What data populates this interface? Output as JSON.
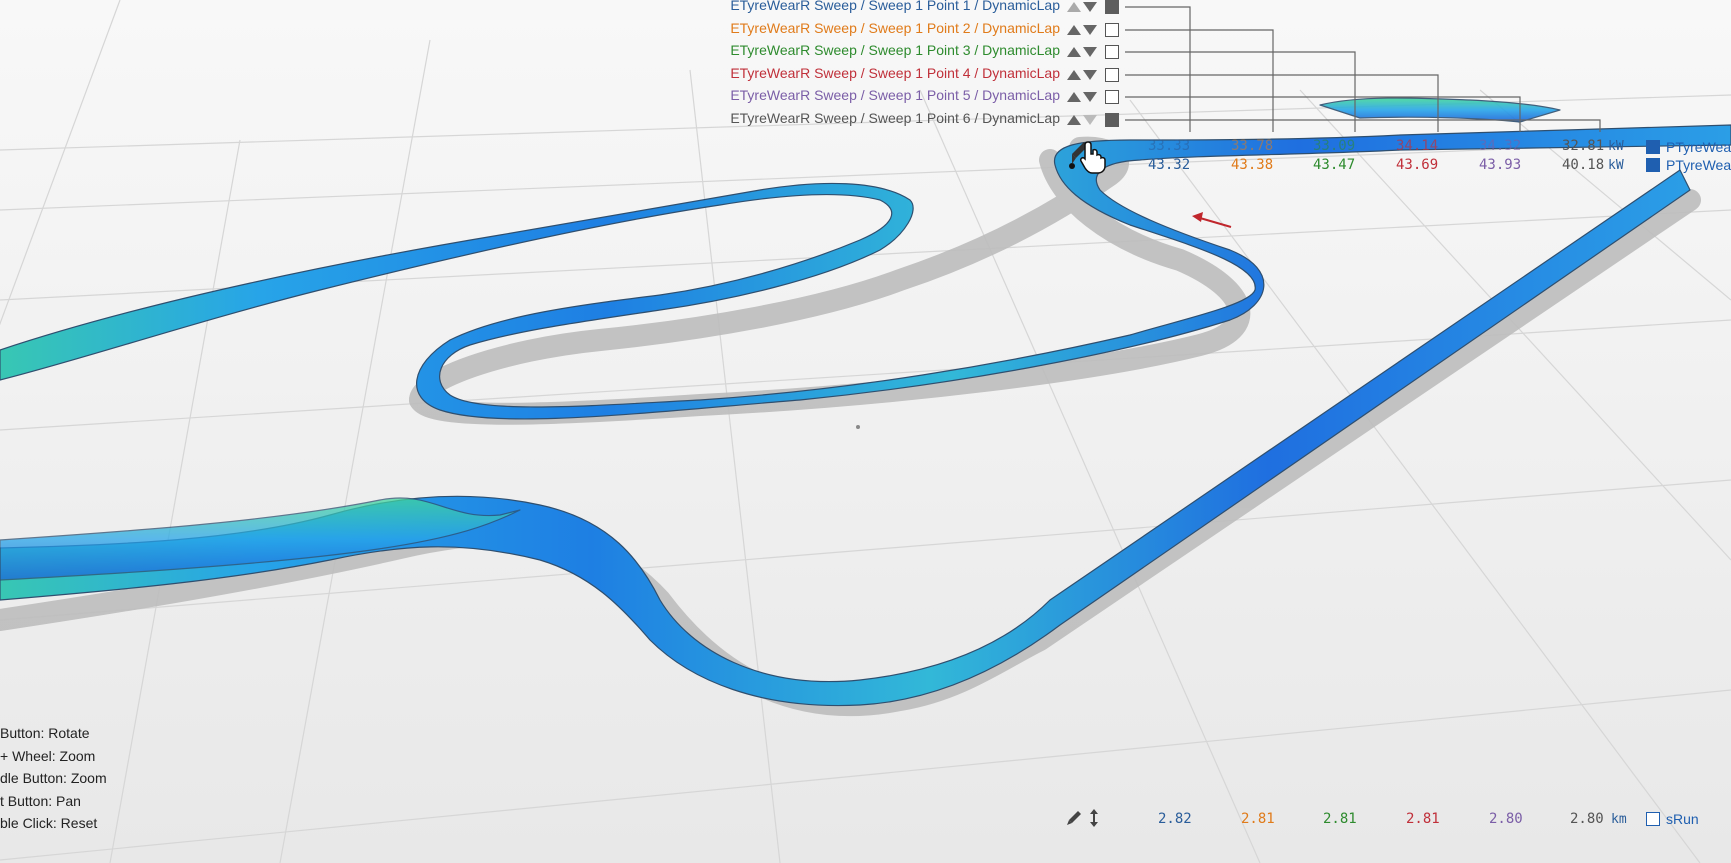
{
  "legend": {
    "items": [
      {
        "label": "ETyreWearR Sweep / Sweep 1 Point 1 / DynamicLap",
        "color": "#2a5d9a",
        "checked": true
      },
      {
        "label": "ETyreWearR Sweep / Sweep 1 Point 2 / DynamicLap",
        "color": "#e07b1a",
        "checked": false
      },
      {
        "label": "ETyreWearR Sweep / Sweep 1 Point 3 / DynamicLap",
        "color": "#2e8b2e",
        "checked": false
      },
      {
        "label": "ETyreWearR Sweep / Sweep 1 Point 4 / DynamicLap",
        "color": "#c0303a",
        "checked": false
      },
      {
        "label": "ETyreWearR Sweep / Sweep 1 Point 5 / DynamicLap",
        "color": "#7b5ea7",
        "checked": false
      },
      {
        "label": "ETyreWearR Sweep / Sweep 1 Point 6 / DynamicLap",
        "color": "#555555",
        "checked": true
      }
    ]
  },
  "readouts": {
    "row1": [
      "33.33",
      "33.78",
      "33.09",
      "34.14",
      "34.32",
      "32.81"
    ],
    "row1_unit": "kW",
    "row2": [
      "43.32",
      "43.38",
      "43.47",
      "43.69",
      "43.93",
      "40.18"
    ],
    "row2_unit": "kW",
    "distance": [
      "2.82",
      "2.81",
      "2.81",
      "2.81",
      "2.80",
      "2.80"
    ],
    "distance_unit": "km"
  },
  "channels": {
    "ch1_label": "PTyreWea",
    "ch2_label": "PTyreWea",
    "srun_label": "sRun"
  },
  "hints": {
    "rotate": "Button: Rotate",
    "wheel_zoom": "+ Wheel: Zoom",
    "middle_zoom": "dle Button: Zoom",
    "pan": "t Button: Pan",
    "reset": "ble Click: Reset"
  },
  "colors": {
    "series": [
      "#2a5d9a",
      "#e07b1a",
      "#2e8b2e",
      "#c0303a",
      "#7b5ea7",
      "#555555"
    ],
    "channel_blue": "#1f5fb0",
    "cursor_arrow": "#c0262c"
  },
  "icons": {
    "cursor": "hand-pointer-icon",
    "brush": "brush-icon",
    "vertical_resize": "vertical-arrows-icon"
  }
}
